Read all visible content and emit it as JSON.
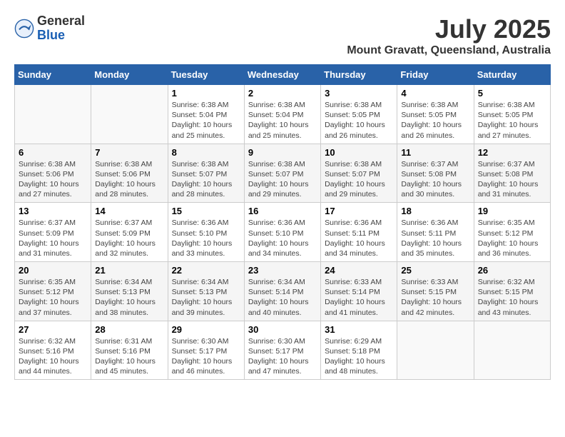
{
  "logo": {
    "general": "General",
    "blue": "Blue"
  },
  "title": {
    "month": "July 2025",
    "location": "Mount Gravatt, Queensland, Australia"
  },
  "weekdays": [
    "Sunday",
    "Monday",
    "Tuesday",
    "Wednesday",
    "Thursday",
    "Friday",
    "Saturday"
  ],
  "weeks": [
    [
      {
        "day": "",
        "info": ""
      },
      {
        "day": "",
        "info": ""
      },
      {
        "day": "1",
        "info": "Sunrise: 6:38 AM\nSunset: 5:04 PM\nDaylight: 10 hours\nand 25 minutes."
      },
      {
        "day": "2",
        "info": "Sunrise: 6:38 AM\nSunset: 5:04 PM\nDaylight: 10 hours\nand 25 minutes."
      },
      {
        "day": "3",
        "info": "Sunrise: 6:38 AM\nSunset: 5:05 PM\nDaylight: 10 hours\nand 26 minutes."
      },
      {
        "day": "4",
        "info": "Sunrise: 6:38 AM\nSunset: 5:05 PM\nDaylight: 10 hours\nand 26 minutes."
      },
      {
        "day": "5",
        "info": "Sunrise: 6:38 AM\nSunset: 5:05 PM\nDaylight: 10 hours\nand 27 minutes."
      }
    ],
    [
      {
        "day": "6",
        "info": "Sunrise: 6:38 AM\nSunset: 5:06 PM\nDaylight: 10 hours\nand 27 minutes."
      },
      {
        "day": "7",
        "info": "Sunrise: 6:38 AM\nSunset: 5:06 PM\nDaylight: 10 hours\nand 28 minutes."
      },
      {
        "day": "8",
        "info": "Sunrise: 6:38 AM\nSunset: 5:07 PM\nDaylight: 10 hours\nand 28 minutes."
      },
      {
        "day": "9",
        "info": "Sunrise: 6:38 AM\nSunset: 5:07 PM\nDaylight: 10 hours\nand 29 minutes."
      },
      {
        "day": "10",
        "info": "Sunrise: 6:38 AM\nSunset: 5:07 PM\nDaylight: 10 hours\nand 29 minutes."
      },
      {
        "day": "11",
        "info": "Sunrise: 6:37 AM\nSunset: 5:08 PM\nDaylight: 10 hours\nand 30 minutes."
      },
      {
        "day": "12",
        "info": "Sunrise: 6:37 AM\nSunset: 5:08 PM\nDaylight: 10 hours\nand 31 minutes."
      }
    ],
    [
      {
        "day": "13",
        "info": "Sunrise: 6:37 AM\nSunset: 5:09 PM\nDaylight: 10 hours\nand 31 minutes."
      },
      {
        "day": "14",
        "info": "Sunrise: 6:37 AM\nSunset: 5:09 PM\nDaylight: 10 hours\nand 32 minutes."
      },
      {
        "day": "15",
        "info": "Sunrise: 6:36 AM\nSunset: 5:10 PM\nDaylight: 10 hours\nand 33 minutes."
      },
      {
        "day": "16",
        "info": "Sunrise: 6:36 AM\nSunset: 5:10 PM\nDaylight: 10 hours\nand 34 minutes."
      },
      {
        "day": "17",
        "info": "Sunrise: 6:36 AM\nSunset: 5:11 PM\nDaylight: 10 hours\nand 34 minutes."
      },
      {
        "day": "18",
        "info": "Sunrise: 6:36 AM\nSunset: 5:11 PM\nDaylight: 10 hours\nand 35 minutes."
      },
      {
        "day": "19",
        "info": "Sunrise: 6:35 AM\nSunset: 5:12 PM\nDaylight: 10 hours\nand 36 minutes."
      }
    ],
    [
      {
        "day": "20",
        "info": "Sunrise: 6:35 AM\nSunset: 5:12 PM\nDaylight: 10 hours\nand 37 minutes."
      },
      {
        "day": "21",
        "info": "Sunrise: 6:34 AM\nSunset: 5:13 PM\nDaylight: 10 hours\nand 38 minutes."
      },
      {
        "day": "22",
        "info": "Sunrise: 6:34 AM\nSunset: 5:13 PM\nDaylight: 10 hours\nand 39 minutes."
      },
      {
        "day": "23",
        "info": "Sunrise: 6:34 AM\nSunset: 5:14 PM\nDaylight: 10 hours\nand 40 minutes."
      },
      {
        "day": "24",
        "info": "Sunrise: 6:33 AM\nSunset: 5:14 PM\nDaylight: 10 hours\nand 41 minutes."
      },
      {
        "day": "25",
        "info": "Sunrise: 6:33 AM\nSunset: 5:15 PM\nDaylight: 10 hours\nand 42 minutes."
      },
      {
        "day": "26",
        "info": "Sunrise: 6:32 AM\nSunset: 5:15 PM\nDaylight: 10 hours\nand 43 minutes."
      }
    ],
    [
      {
        "day": "27",
        "info": "Sunrise: 6:32 AM\nSunset: 5:16 PM\nDaylight: 10 hours\nand 44 minutes."
      },
      {
        "day": "28",
        "info": "Sunrise: 6:31 AM\nSunset: 5:16 PM\nDaylight: 10 hours\nand 45 minutes."
      },
      {
        "day": "29",
        "info": "Sunrise: 6:30 AM\nSunset: 5:17 PM\nDaylight: 10 hours\nand 46 minutes."
      },
      {
        "day": "30",
        "info": "Sunrise: 6:30 AM\nSunset: 5:17 PM\nDaylight: 10 hours\nand 47 minutes."
      },
      {
        "day": "31",
        "info": "Sunrise: 6:29 AM\nSunset: 5:18 PM\nDaylight: 10 hours\nand 48 minutes."
      },
      {
        "day": "",
        "info": ""
      },
      {
        "day": "",
        "info": ""
      }
    ]
  ]
}
